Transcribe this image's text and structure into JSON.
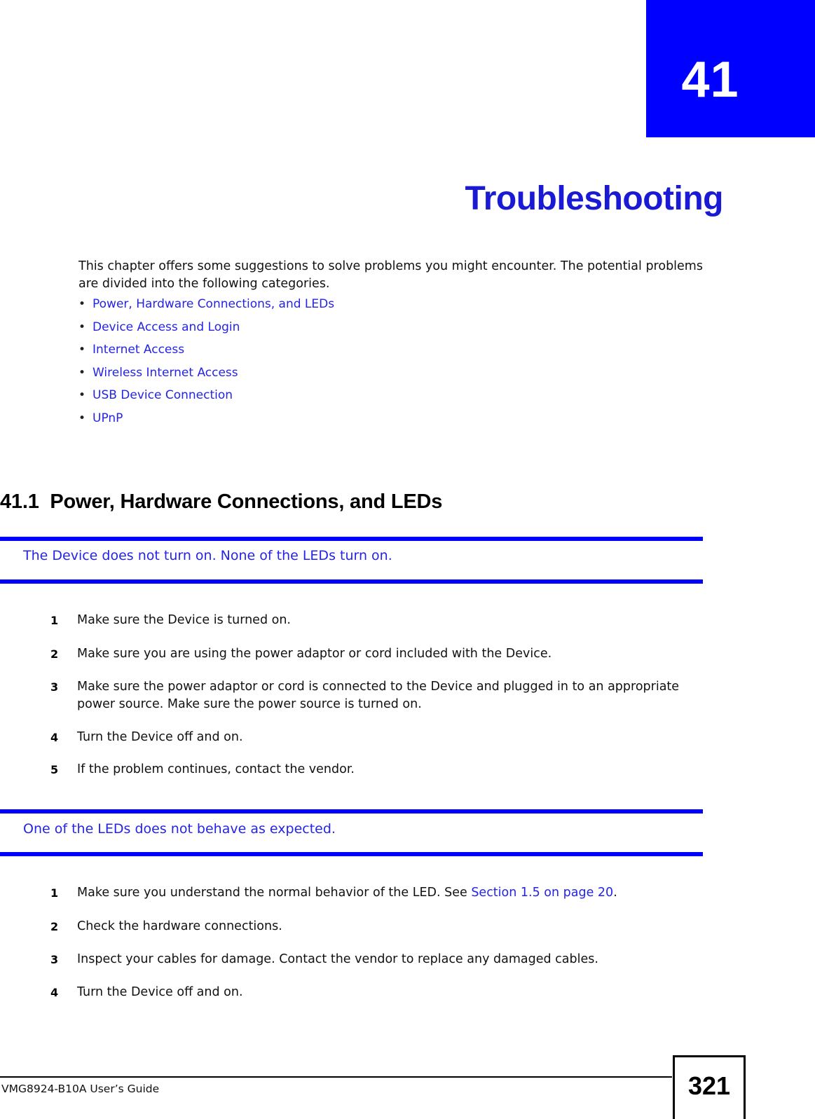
{
  "chapter": {
    "number": "41",
    "title": "Troubleshooting"
  },
  "intro": {
    "paragraph": "This chapter offers some suggestions to solve problems you might encounter. The potential problems are divided into the following categories."
  },
  "toc_links": [
    {
      "bullet": "•",
      "label": "Power, Hardware Connections, and LEDs"
    },
    {
      "bullet": "•",
      "label": "Device Access and Login"
    },
    {
      "bullet": "•",
      "label": "Internet Access"
    },
    {
      "bullet": "•",
      "label": "Wireless Internet Access"
    },
    {
      "bullet": "•",
      "label": "USB Device Connection"
    },
    {
      "bullet": "•",
      "label": "UPnP"
    }
  ],
  "section": {
    "heading": "41.1  Power, Hardware Connections, and LEDs"
  },
  "problems": [
    {
      "question": "The Device does not turn on. None of the LEDs turn on.",
      "steps": [
        {
          "num": "1",
          "text": "Make sure the Device is turned on."
        },
        {
          "num": "2",
          "text": "Make sure you are using the power adaptor or cord included with the Device."
        },
        {
          "num": "3",
          "text": "Make sure the power adaptor or cord is connected to the Device and plugged in to an appropriate power source. Make sure the power source is turned on."
        },
        {
          "num": "4",
          "text": "Turn the Device off and on."
        },
        {
          "num": "5",
          "text": "If the problem continues, contact the vendor."
        }
      ]
    },
    {
      "question": "One of the LEDs does not behave as expected.",
      "steps": [
        {
          "num": "1",
          "text_before": "Make sure you understand the normal behavior of the LED. See ",
          "link": "Section 1.5 on page 20",
          "text_after": "."
        },
        {
          "num": "2",
          "text": "Check the hardware connections."
        },
        {
          "num": "3",
          "text": "Inspect your cables for damage. Contact the vendor to replace any damaged cables."
        },
        {
          "num": "4",
          "text": "Turn the Device off and on."
        }
      ]
    }
  ],
  "footer": {
    "guide_name": "VMG8924-B10A User’s Guide",
    "page_number": "321"
  },
  "colors": {
    "banner_blue": "#0000ff",
    "title_blue": "#1a1ad4",
    "link_blue": "#2424e8",
    "rule_blue": "#0000ff"
  }
}
